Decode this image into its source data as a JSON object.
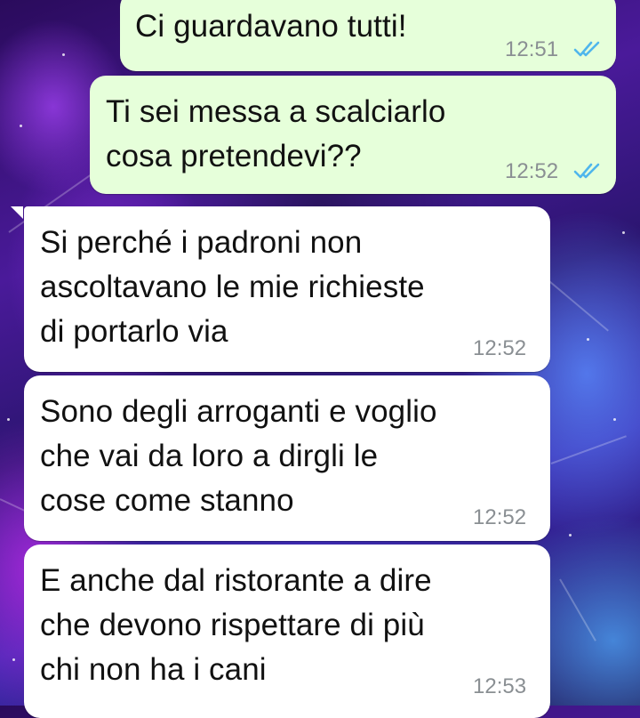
{
  "messages": [
    {
      "text": "Ci guardavano tutti!",
      "time": "12:51",
      "direction": "outgoing",
      "status_icon": "double-check-read-icon"
    },
    {
      "text": "Ti sei messa a scalciarlo\ncosa pretendevi??",
      "time": "12:52",
      "direction": "outgoing",
      "status_icon": "double-check-read-icon"
    },
    {
      "text": "Si perché i padroni non\nascoltavano le mie richieste\ndi portarlo via",
      "time": "12:52",
      "direction": "incoming"
    },
    {
      "text": "Sono degli arroganti e voglio\nche vai da loro a dirgli le\ncose come stanno",
      "time": "12:52",
      "direction": "incoming"
    },
    {
      "text": "E anche dal ristorante a dire\nche devono rispettare di più\nchi non ha i cani",
      "time": "12:53",
      "direction": "incoming"
    }
  ],
  "colors": {
    "outgoing_bubble": "#e6ffda",
    "incoming_bubble": "#ffffff",
    "read_ticks": "#4fb6ec",
    "timestamp": "#8a8f93"
  }
}
